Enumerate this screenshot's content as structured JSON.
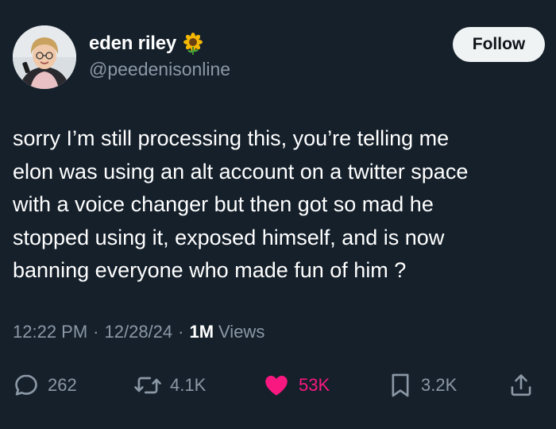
{
  "user": {
    "display_name": "eden riley",
    "badge_icon": "sunflower-icon",
    "handle": "@peedenisonline"
  },
  "follow_label": "Follow",
  "tweet_text": "sorry I’m still processing this, you’re telling me\nelon was using an alt account on a twitter space\nwith a voice changer but then got so mad he\nstopped using it, exposed himself, and is now\nbanning everyone who made fun of him ?",
  "meta": {
    "time": "12:22 PM",
    "separator": "·",
    "date": "12/28/24",
    "views_count": "1M",
    "views_label": "Views"
  },
  "actions": {
    "replies": "262",
    "reposts": "4.1K",
    "likes": "53K",
    "bookmarks": "3.2K"
  },
  "colors": {
    "background": "#15202b",
    "secondary_text": "#8b98a5",
    "like_pink": "#f91880",
    "follow_bg": "#eff3f4"
  }
}
